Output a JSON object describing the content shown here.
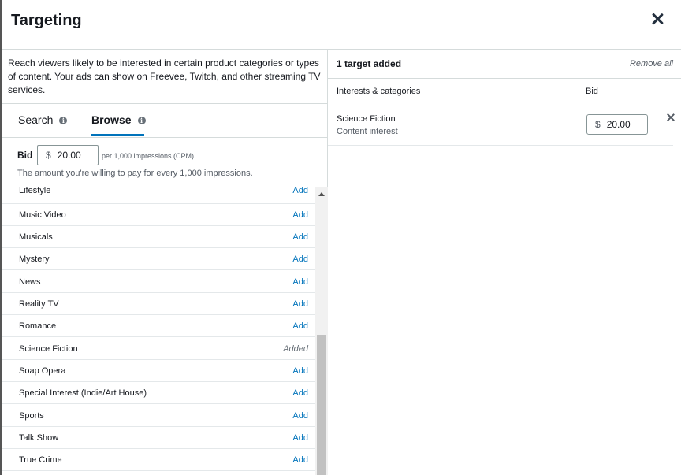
{
  "header": {
    "title": "Targeting"
  },
  "left": {
    "description": "Reach viewers likely to be interested in certain product categories or types of content. Your ads can show on Freevee, Twitch, and other streaming TV services.",
    "tabs": {
      "search": "Search",
      "browse": "Browse",
      "active": "Browse"
    },
    "bid": {
      "label": "Bid",
      "currency": "$",
      "value": "20.00",
      "unit": "per 1,000 impressions (CPM)",
      "hint": "The amount you're willing to pay for every 1,000 impressions."
    },
    "items": [
      {
        "name": "Lifestyle",
        "action": "Add"
      },
      {
        "name": "Music Video",
        "action": "Add"
      },
      {
        "name": "Musicals",
        "action": "Add"
      },
      {
        "name": "Mystery",
        "action": "Add"
      },
      {
        "name": "News",
        "action": "Add"
      },
      {
        "name": "Reality TV",
        "action": "Add"
      },
      {
        "name": "Romance",
        "action": "Add"
      },
      {
        "name": "Science Fiction",
        "action": "Added"
      },
      {
        "name": "Soap Opera",
        "action": "Add"
      },
      {
        "name": "Special Interest (Indie/Art House)",
        "action": "Add"
      },
      {
        "name": "Sports",
        "action": "Add"
      },
      {
        "name": "Talk Show",
        "action": "Add"
      },
      {
        "name": "True Crime",
        "action": "Add"
      }
    ]
  },
  "right": {
    "count_label": "1 target added",
    "remove_all": "Remove all",
    "columns": {
      "interests": "Interests & categories",
      "bid": "Bid"
    },
    "targets": [
      {
        "name": "Science Fiction",
        "type": "Content interest",
        "currency": "$",
        "bid": "20.00"
      }
    ]
  },
  "colors": {
    "link": "#0073bb",
    "tab_underline": "#0073bb",
    "text": "#16191f",
    "muted": "#545b64"
  },
  "icons": {
    "close": "close-icon",
    "info": "info-icon",
    "remove_target": "close-icon",
    "scroll_up": "chevron-up-icon"
  }
}
